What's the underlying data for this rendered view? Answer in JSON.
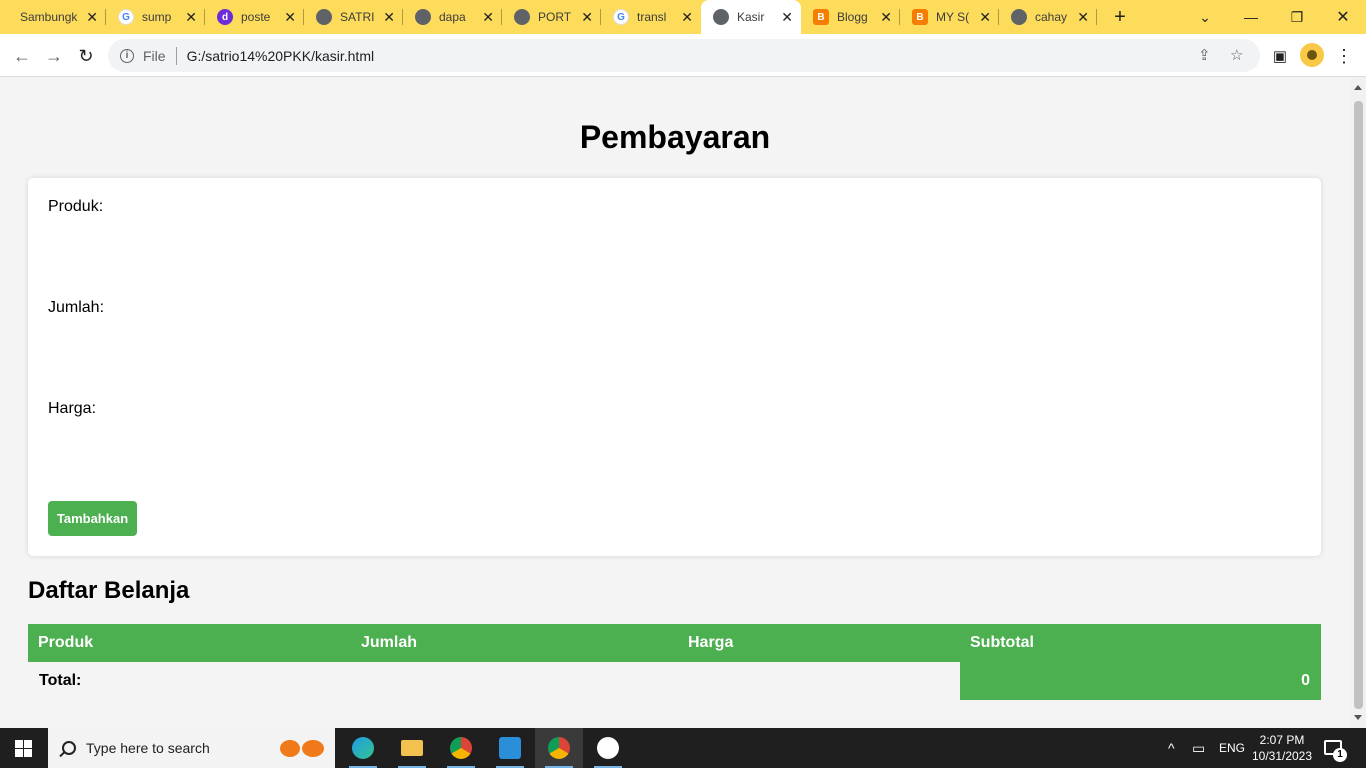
{
  "browser": {
    "tabs": [
      {
        "title": "Sambungk",
        "icon": "none",
        "active": false
      },
      {
        "title": "sump",
        "icon": "google",
        "active": false
      },
      {
        "title": "poste",
        "icon": "d-badge",
        "active": false
      },
      {
        "title": "SATRI",
        "icon": "globe",
        "active": false
      },
      {
        "title": "dapa",
        "icon": "globe",
        "active": false
      },
      {
        "title": "PORT",
        "icon": "globe",
        "active": false
      },
      {
        "title": "transl",
        "icon": "google",
        "active": false
      },
      {
        "title": "Kasir",
        "icon": "globe",
        "active": true
      },
      {
        "title": "Blogg",
        "icon": "blogger",
        "active": false
      },
      {
        "title": "MY S(",
        "icon": "blogger",
        "active": false
      },
      {
        "title": "cahay",
        "icon": "globe",
        "active": false
      }
    ],
    "close_glyph": "✕",
    "new_tab_glyph": "+",
    "address": {
      "scheme_label": "File",
      "url": "G:/satrio14%20PKK/kasir.html"
    },
    "colors": {
      "tab_strip": "#fddc5c",
      "avatar": "#f9c846"
    }
  },
  "page": {
    "title": "Pembayaran",
    "form": {
      "product_label": "Produk:",
      "product_value": "",
      "quantity_label": "Jumlah:",
      "quantity_value": "",
      "price_label": "Harga:",
      "price_value": "",
      "add_button": "Tambahkan"
    },
    "cart": {
      "heading": "Daftar Belanja",
      "columns": [
        "Produk",
        "Jumlah",
        "Harga",
        "Subtotal"
      ],
      "rows": [],
      "total_label": "Total:",
      "total_value": "0"
    },
    "colors": {
      "accent": "#4caf50",
      "background": "#f4f4f4"
    }
  },
  "taskbar": {
    "search_placeholder": "Type here to search",
    "apps": [
      "edge",
      "file-explorer",
      "chrome",
      "vscode",
      "chrome-profile",
      "photos"
    ],
    "language": "ENG",
    "time": "2:07 PM",
    "date": "10/31/2023",
    "notification_count": "1"
  }
}
